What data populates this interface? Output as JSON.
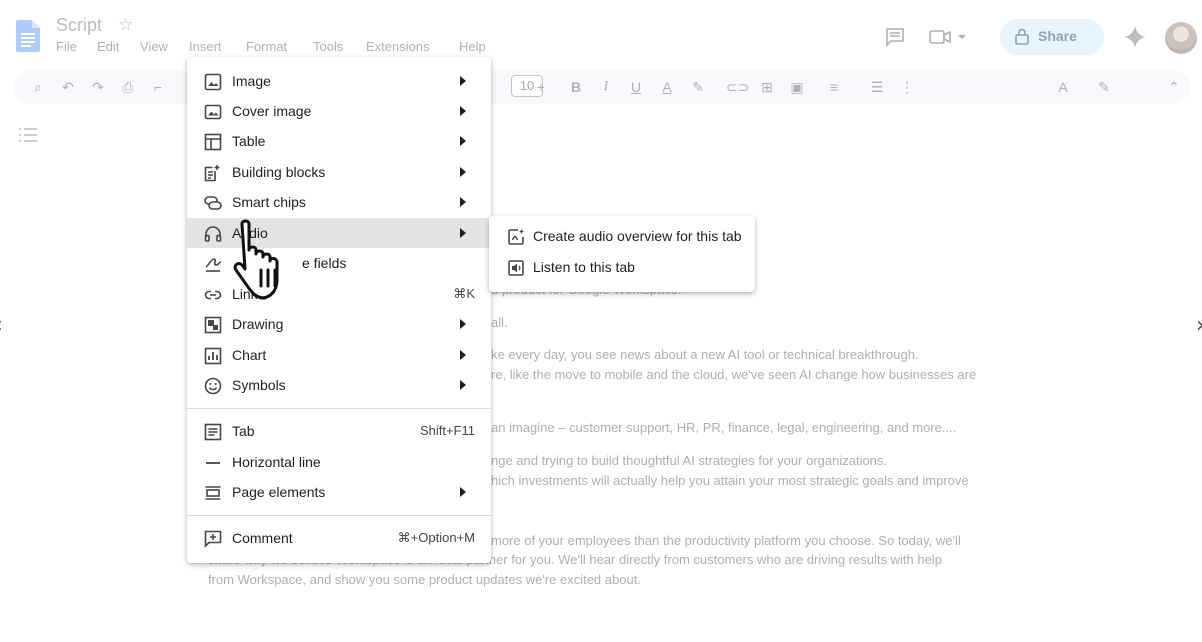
{
  "document": {
    "title": "Script",
    "star_icon": "star-icon"
  },
  "menubar": [
    "File",
    "Edit",
    "View",
    "Insert",
    "Format",
    "Tools",
    "Extensions",
    "Help"
  ],
  "header": {
    "share_label": "Share"
  },
  "toolbar": {
    "font_size": "10"
  },
  "insert_menu": {
    "items": [
      {
        "label": "Image",
        "icon": "image-icon",
        "shortcut": "",
        "submenu": true
      },
      {
        "label": "Cover image",
        "icon": "cover-image-icon",
        "shortcut": "",
        "submenu": true
      },
      {
        "label": "Table",
        "icon": "table-icon",
        "shortcut": "",
        "submenu": true
      },
      {
        "label": "Building blocks",
        "icon": "building-blocks-icon",
        "shortcut": "",
        "submenu": true
      },
      {
        "label": "Smart chips",
        "icon": "smart-chips-icon",
        "shortcut": "",
        "submenu": true
      },
      {
        "label": "Audio",
        "icon": "headphones-icon",
        "shortcut": "",
        "submenu": true,
        "active": true
      },
      {
        "label": "e fields",
        "icon": "signature-icon",
        "shortcut": "",
        "submenu": false
      },
      {
        "label": "Link",
        "icon": "link-icon",
        "shortcut": "⌘K",
        "submenu": false
      },
      {
        "label": "Drawing",
        "icon": "drawing-icon",
        "shortcut": "",
        "submenu": true
      },
      {
        "label": "Chart",
        "icon": "chart-icon",
        "shortcut": "",
        "submenu": true
      },
      {
        "label": "Symbols",
        "icon": "emoji-icon",
        "shortcut": "",
        "submenu": true
      },
      {
        "label": "Tab",
        "icon": "tab-icon",
        "shortcut": "Shift+F11",
        "submenu": false
      },
      {
        "label": "Horizontal line",
        "icon": "horizontal-line-icon",
        "shortcut": "",
        "submenu": false
      },
      {
        "label": "Page elements",
        "icon": "page-elements-icon",
        "shortcut": "",
        "submenu": true
      },
      {
        "label": "Comment",
        "icon": "add-comment-icon",
        "shortcut": "⌘+Option+M",
        "submenu": false
      }
    ]
  },
  "audio_submenu": {
    "items": [
      {
        "label": "Create audio overview for this tab",
        "icon": "audio-overview-icon"
      },
      {
        "label": "Listen to this tab",
        "icon": "listen-icon"
      }
    ]
  },
  "doc_body": {
    "lines": [
      "d product for Google Workspace.",
      "all.",
      "ke every day, you see news about a new AI tool or technical breakthrough.",
      "re, like the move to mobile and the cloud, we've seen AI change how businesses are",
      "an imagine – customer support, HR, PR, finance, legal, engineering, and more....",
      "nge and trying to build thoughtful AI strategies for your organizations.",
      "hich investments will actually help you attain your most strategic goals and improve",
      "more of your employees than the productivity platform you choose. So today, we'll",
      "share why we believe Workspace is an ideal partner for you. We'll hear directly from customers who are driving results with help",
      "from Workspace, and show you some product updates we're excited about."
    ]
  }
}
